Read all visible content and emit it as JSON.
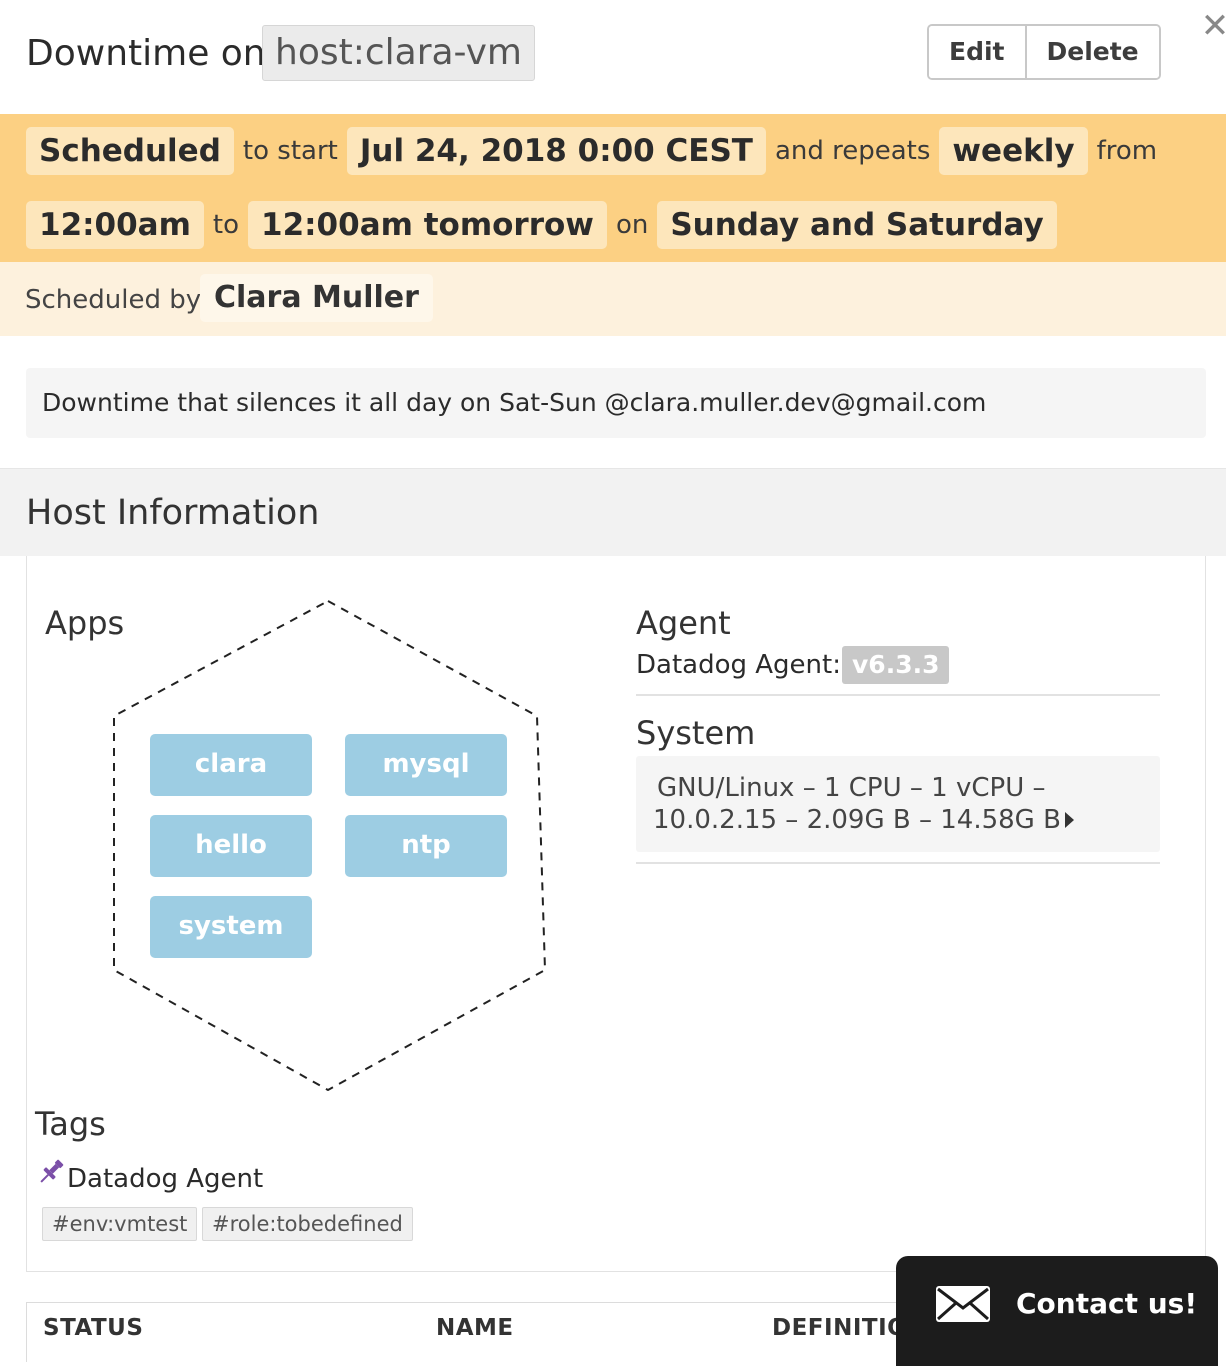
{
  "header": {
    "title": "Downtime on",
    "scope": "host:clara-vm",
    "edit_label": "Edit",
    "delete_label": "Delete"
  },
  "schedule": {
    "status": "Scheduled",
    "to_start": "to start",
    "start": "Jul 24, 2018 0:00 CEST",
    "and_repeats": "and repeats",
    "frequency": "weekly",
    "from": "from",
    "from_time": "12:00am",
    "to": "to",
    "to_time": "12:00am tomorrow",
    "on": "on",
    "days": "Sunday and Saturday",
    "scheduled_by_label": "Scheduled by",
    "scheduled_by_name": "Clara Muller"
  },
  "message": "Downtime that silences it all day on Sat-Sun @clara.muller.dev@gmail.com",
  "host_info": {
    "title": "Host Information",
    "apps_title": "Apps",
    "apps": [
      "clara",
      "mysql",
      "hello",
      "ntp",
      "system"
    ],
    "agent_title": "Agent",
    "agent_label": "Datadog Agent:",
    "agent_version": "v6.3.3",
    "system_title": "System",
    "system_line1": "GNU/Linux – 1 CPU – 1 vCPU –",
    "system_line2": "10.0.2.15 – 2.09G B – 14.58G B",
    "tags_title": "Tags",
    "tag_source": "Datadog Agent",
    "tags": [
      "#env:vmtest",
      "#role:tobedefined"
    ]
  },
  "table": {
    "columns": [
      "STATUS",
      "NAME",
      "DEFINITIO"
    ]
  },
  "contact": {
    "label": "Contact us!"
  },
  "colors": {
    "schedule_band": "#fcd083",
    "byline_band": "#fdf1dd",
    "app_chip": "#9dcde3",
    "tag_pin": "#7b4fa8"
  }
}
